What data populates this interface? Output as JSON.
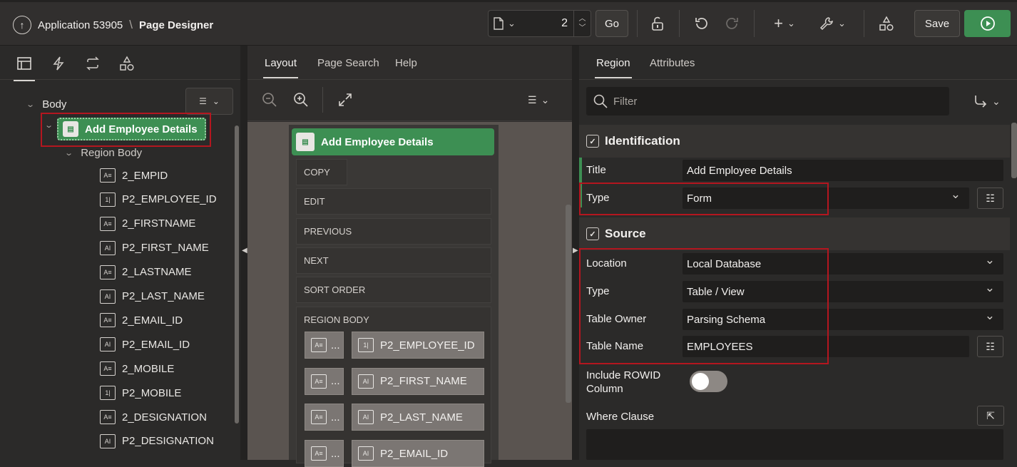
{
  "header": {
    "app_title": "Application 53905",
    "separator": "\\",
    "page_title": "Page Designer",
    "page_number": "2",
    "go_label": "Go",
    "save_label": "Save"
  },
  "left_tree": {
    "body_label": "Body",
    "region_label": "Add Employee Details",
    "region_body_label": "Region Body",
    "items": [
      {
        "label": "2_EMPID",
        "icon": "A≡"
      },
      {
        "label": "P2_EMPLOYEE_ID",
        "icon": "1|"
      },
      {
        "label": "2_FIRSTNAME",
        "icon": "A≡"
      },
      {
        "label": "P2_FIRST_NAME",
        "icon": "AI"
      },
      {
        "label": "2_LASTNAME",
        "icon": "A≡"
      },
      {
        "label": "P2_LAST_NAME",
        "icon": "AI"
      },
      {
        "label": "2_EMAIL_ID",
        "icon": "A≡"
      },
      {
        "label": "P2_EMAIL_ID",
        "icon": "AI"
      },
      {
        "label": "2_MOBILE",
        "icon": "A≡"
      },
      {
        "label": "P2_MOBILE",
        "icon": "1|"
      },
      {
        "label": "2_DESIGNATION",
        "icon": "A≡"
      },
      {
        "label": "P2_DESIGNATION",
        "icon": "AI"
      }
    ]
  },
  "middle": {
    "tabs": [
      "Layout",
      "Page Search",
      "Help"
    ],
    "region_title": "Add Employee Details",
    "slots": [
      "COPY",
      "EDIT",
      "PREVIOUS",
      "NEXT",
      "SORT ORDER"
    ],
    "region_body_label": "REGION BODY",
    "canvas_items": [
      {
        "label": "P2_EMPLOYEE_ID",
        "icon": "1|",
        "label_icon": "A≡",
        "ellipsis": "..."
      },
      {
        "label": "P2_FIRST_NAME",
        "icon": "AI",
        "label_icon": "A≡",
        "ellipsis": "..."
      },
      {
        "label": "P2_LAST_NAME",
        "icon": "AI",
        "label_icon": "A≡",
        "ellipsis": "..."
      },
      {
        "label": "P2_EMAIL_ID",
        "icon": "AI",
        "label_icon": "A≡",
        "ellipsis": "..."
      }
    ]
  },
  "right": {
    "tabs": [
      "Region",
      "Attributes"
    ],
    "filter_placeholder": "Filter",
    "identification": {
      "heading": "Identification",
      "title_label": "Title",
      "title_value": "Add Employee Details",
      "type_label": "Type",
      "type_value": "Form"
    },
    "source": {
      "heading": "Source",
      "location_label": "Location",
      "location_value": "Local Database",
      "type_label": "Type",
      "type_value": "Table / View",
      "owner_label": "Table Owner",
      "owner_value": "Parsing Schema",
      "table_label": "Table Name",
      "table_value": "EMPLOYEES",
      "rowid_label_line1": "Include ROWID",
      "rowid_label_line2": "Column",
      "rowid_enabled": false,
      "where_label": "Where Clause"
    }
  },
  "colors": {
    "accent_green": "#3d8f53",
    "highlight_red": "#b4161f",
    "background": "#2b2a29"
  }
}
